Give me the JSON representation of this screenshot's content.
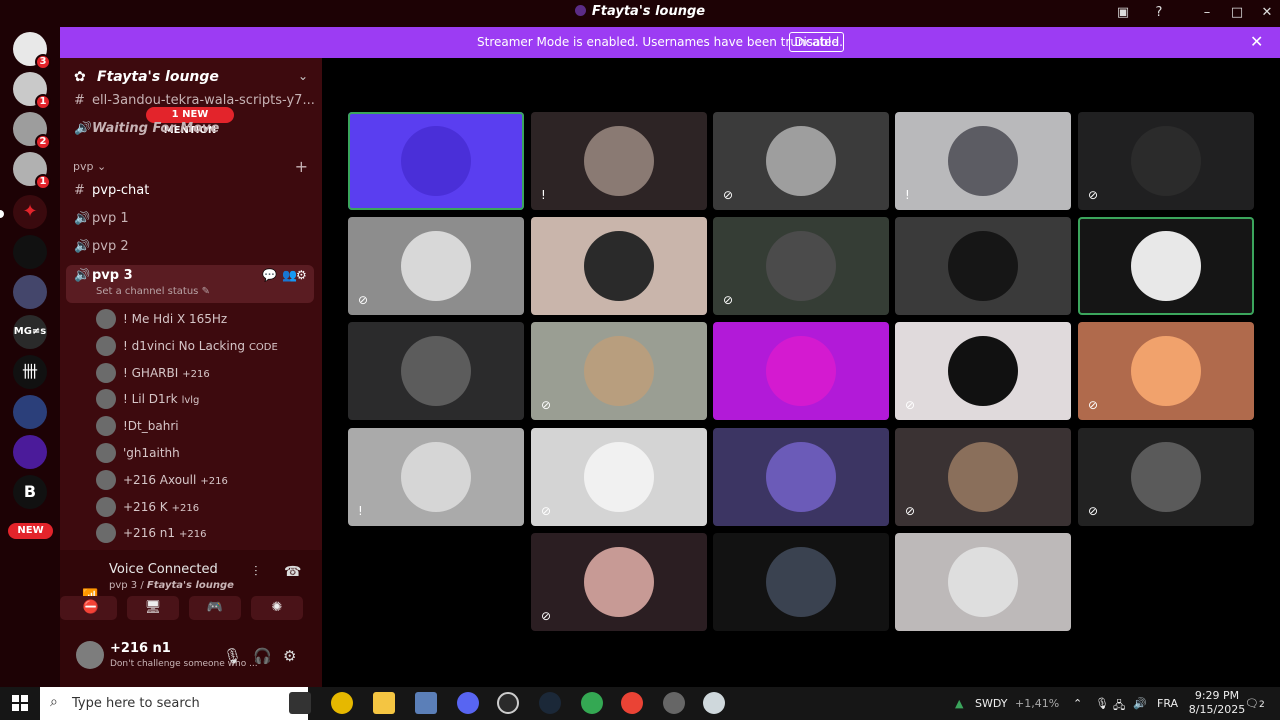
{
  "window": {
    "title": "Ftayta's lounge"
  },
  "server_rail": {
    "badges": [
      "3",
      "1",
      "2",
      "1"
    ],
    "new_label": "NEW",
    "text_icon": "MG≠s"
  },
  "banner": {
    "text": "Streamer Mode is enabled. Usernames have been truncated.",
    "button": "Disable"
  },
  "sidebar": {
    "guild_name": "Ftayta's lounge",
    "channels_top": [
      {
        "icon": "#",
        "name": "ell-3andou-tekra-wala-scripts-y7..."
      },
      {
        "icon": "🔊",
        "name": "Waiting For Move"
      }
    ],
    "mention_pill": "1 NEW MENTION",
    "category": "pvp",
    "channels": [
      {
        "icon": "#",
        "name": "pvp-chat"
      },
      {
        "icon": "🔊",
        "name": "pvp 1"
      },
      {
        "icon": "🔊",
        "name": "pvp 2"
      },
      {
        "icon": "🔊",
        "name": "pvp 3"
      }
    ],
    "channel_status_placeholder": "Set a channel status",
    "voice_users": [
      {
        "name": "! Me Hdi X 165Hz",
        "tag": ""
      },
      {
        "name": "! d1vinci No Lacking",
        "tag": "CODE"
      },
      {
        "name": "! GHARBI",
        "tag": "+216"
      },
      {
        "name": "! Lil D1rk",
        "tag": "lvlg"
      },
      {
        "name": "!Dt_bahri",
        "tag": ""
      },
      {
        "name": "'gh1aithh",
        "tag": ""
      },
      {
        "name": "+216 Axoull",
        "tag": "+216"
      },
      {
        "name": "+216 K",
        "tag": "+216"
      },
      {
        "name": "+216 n1",
        "tag": "+216"
      }
    ]
  },
  "voice_panel": {
    "status": "Voice Connected",
    "channel": "pvp 3 / ",
    "guild": "Ftayta's lounge"
  },
  "user_panel": {
    "name": "+216 n1",
    "status": "Don't challenge someone who ..."
  },
  "stage": {
    "tiles": [
      {
        "bg": "#5a3ef0",
        "pic": "#4a2fd8",
        "speaking": true,
        "mute": ""
      },
      {
        "bg": "#2d2425",
        "pic": "#8a7a73",
        "speaking": false,
        "mute": "!"
      },
      {
        "bg": "#3b3b3b",
        "pic": "#9e9e9e",
        "speaking": false,
        "mute": "⊘"
      },
      {
        "bg": "#b9b9bb",
        "pic": "#5c5c63",
        "speaking": false,
        "mute": "!"
      },
      {
        "bg": "#202021",
        "pic": "#2b2b2b",
        "speaking": false,
        "mute": "⊘"
      },
      {
        "bg": "#8d8d8d",
        "pic": "#d8d8d8",
        "speaking": false,
        "mute": "⊘"
      },
      {
        "bg": "#c9b5ab",
        "pic": "#2a2a2a",
        "speaking": false,
        "mute": ""
      },
      {
        "bg": "#353d35",
        "pic": "#4b4b4b",
        "speaking": false,
        "mute": "⊘"
      },
      {
        "bg": "#3a3a3a",
        "pic": "#161616",
        "speaking": false,
        "mute": ""
      },
      {
        "bg": "#151515",
        "pic": "#e8e8e8",
        "speaking": true,
        "mute": ""
      },
      {
        "bg": "#2b2b2c",
        "pic": "#5c5c5c",
        "speaking": false,
        "mute": ""
      },
      {
        "bg": "#9a9e93",
        "pic": "#b89e7e",
        "speaking": false,
        "mute": "⊘"
      },
      {
        "bg": "#b21ad8",
        "pic": "#d41ad0",
        "speaking": false,
        "mute": ""
      },
      {
        "bg": "#e0dadc",
        "pic": "#111111",
        "speaking": false,
        "mute": "⊘"
      },
      {
        "bg": "#b06a4c",
        "pic": "#f1a26c",
        "speaking": false,
        "mute": "⊘"
      },
      {
        "bg": "#aaaaaa",
        "pic": "#d6d6d6",
        "speaking": false,
        "mute": "!"
      },
      {
        "bg": "#d4d4d4",
        "pic": "#f1f1f1",
        "speaking": false,
        "mute": "⊘"
      },
      {
        "bg": "#3c3563",
        "pic": "#6b5bb8",
        "speaking": false,
        "mute": ""
      },
      {
        "bg": "#3a3233",
        "pic": "#8a6f5b",
        "speaking": false,
        "mute": "⊘"
      },
      {
        "bg": "#222222",
        "pic": "#5a5a5a",
        "speaking": false,
        "mute": "⊘"
      },
      {
        "bg": "#2b1e22",
        "pic": "#c79a95",
        "speaking": false,
        "mute": "⊘"
      },
      {
        "bg": "#121212",
        "pic": "#3a4250",
        "speaking": false,
        "mute": ""
      },
      {
        "bg": "#bdb9b9",
        "pic": "#dedede",
        "speaking": false,
        "mute": ""
      }
    ]
  },
  "taskbar": {
    "search_placeholder": "Type here to search",
    "ticker": "SWDY",
    "ticker_change": "+1,41%",
    "lang": "FRA",
    "time": "9:29 PM",
    "date": "8/15/2025",
    "notifications": "2"
  }
}
